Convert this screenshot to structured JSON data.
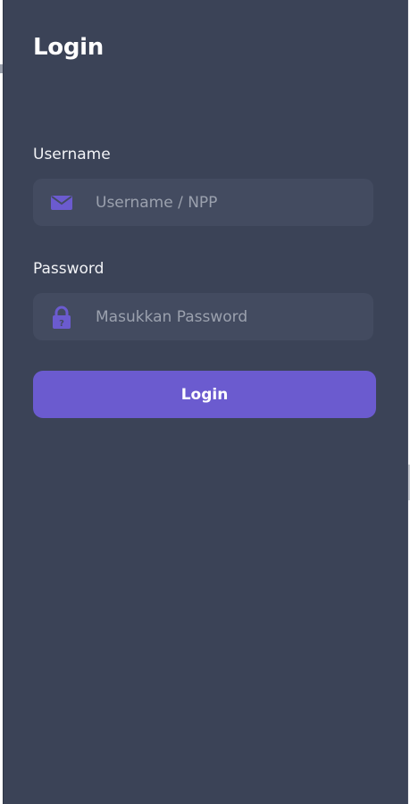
{
  "form": {
    "title": "Login",
    "username": {
      "label": "Username",
      "placeholder": "Username / NPP",
      "value": "",
      "icon": "envelope-icon"
    },
    "password": {
      "label": "Password",
      "placeholder": "Masukkan Password",
      "value": "",
      "icon": "lock-icon"
    },
    "submit_label": "Login"
  },
  "colors": {
    "panel_background": "#3b4357",
    "input_background": "#434b60",
    "accent": "#6b5bcf",
    "text": "#ffffff",
    "placeholder": "#9ba1ae"
  }
}
